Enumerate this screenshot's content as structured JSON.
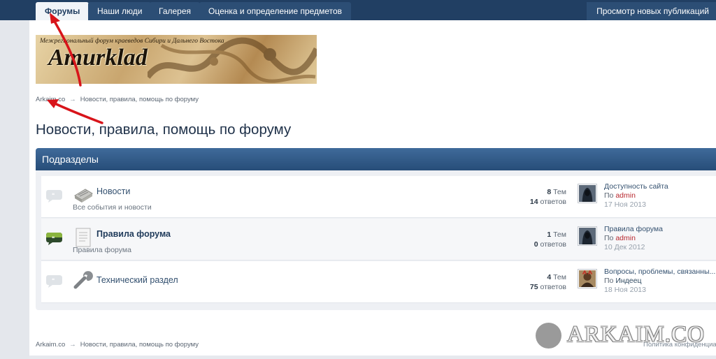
{
  "nav": {
    "tabs": [
      {
        "label": "Форумы",
        "active": true
      },
      {
        "label": "Наши люди"
      },
      {
        "label": "Галерея"
      },
      {
        "label": "Оценка и определение предметов"
      }
    ],
    "right_link": "Просмотр новых публикаций"
  },
  "banner": {
    "subtitle": "Межрегиональный форум краеведов Сибири и Дальнего Востока",
    "logo": "Amurklad"
  },
  "breadcrumb": {
    "home": "Arkaim.co",
    "arrow": "→",
    "current": "Новости, правила, помощь по форуму"
  },
  "page_title": "Новости, правила, помощь по форуму",
  "section": {
    "title": "Подразделы",
    "forums": [
      {
        "name": "Новости",
        "description": "Все события и новости",
        "topics_count": "8",
        "topics_label": "Тем",
        "posts_count": "14",
        "posts_label": "ответов",
        "last_title": "Доступность сайта",
        "last_by": "По",
        "last_user": "admin",
        "last_date": "17 Ноя 2013",
        "icon": "newspaper-icon",
        "unread": false
      },
      {
        "name": "Правила форума",
        "description": "Правила форума",
        "topics_count": "1",
        "topics_label": "Тем",
        "posts_count": "0",
        "posts_label": "ответов",
        "last_title": "Правила форума",
        "last_by": "По",
        "last_user": "admin",
        "last_date": "10 Дек 2012",
        "icon": "document-icon",
        "unread": true
      },
      {
        "name": "Технический раздел",
        "description": "",
        "topics_count": "4",
        "topics_label": "Тем",
        "posts_count": "75",
        "posts_label": "ответов",
        "last_title": "Вопросы, проблемы, связанны...",
        "last_by": "По",
        "last_user": "Индеец",
        "last_date": "18 Ноя 2013",
        "icon": "wrench-icon",
        "unread": false
      }
    ]
  },
  "footer": {
    "policy": "Политика конфиденциа"
  },
  "watermark": "ARKAIM.CO",
  "colors": {
    "nav_bg": "#213f63",
    "section_header": "#2f5a88",
    "annotation_red": "#d8141a",
    "username": "#b8282f"
  }
}
